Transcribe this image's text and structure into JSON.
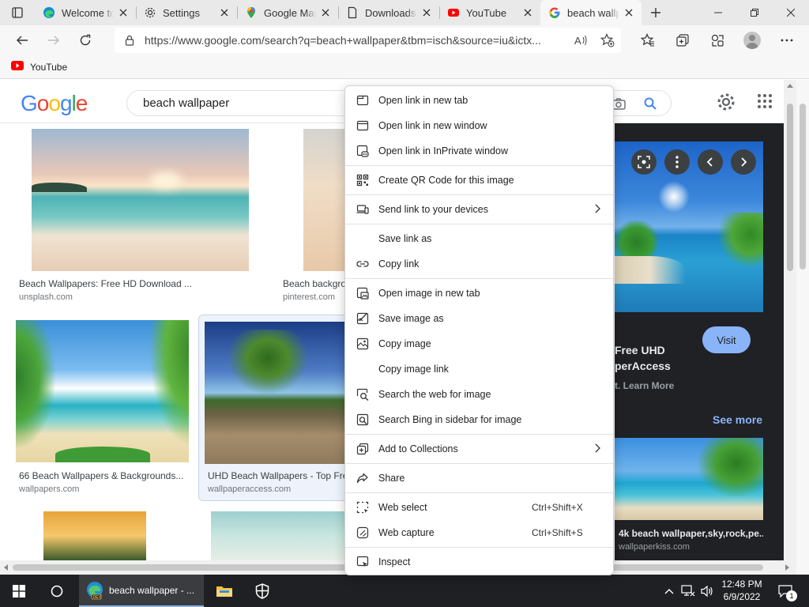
{
  "tabs": [
    {
      "title": "Welcome to Microsoft Edge",
      "icon": "edge-icon"
    },
    {
      "title": "Settings",
      "icon": "gear-icon"
    },
    {
      "title": "Google Maps",
      "icon": "maps-pin-icon"
    },
    {
      "title": "Downloads",
      "icon": "document-icon"
    },
    {
      "title": "YouTube",
      "icon": "youtube-icon"
    },
    {
      "title": "beach wallpaper - Google Search",
      "icon": "google-g-icon"
    }
  ],
  "address": {
    "url": "https://www.google.com/search?q=beach+wallpaper&tbm=isch&source=iu&ictx..."
  },
  "favorites": [
    {
      "label": "YouTube"
    }
  ],
  "google": {
    "logo": "Google",
    "query": "beach wallpaper"
  },
  "results": [
    {
      "caption": "Beach Wallpapers: Free HD Download ...",
      "source": "unsplash.com"
    },
    {
      "caption": "Beach backgrounds",
      "source": "pinterest.com"
    },
    {
      "caption": "66 Beach Wallpapers & Backgrounds...",
      "source": "wallpapers.com"
    },
    {
      "caption": "UHD Beach Wallpapers - Top Free",
      "source": "wallpaperaccess.com"
    }
  ],
  "panel": {
    "title": "Free UHD\nperAccess",
    "learn": "t. Learn More",
    "visit": "Visit",
    "see_more": "See more",
    "related_caption": "4k beach wallpaper,sky,rock,pe...",
    "related_source": "wallpaperkiss.com"
  },
  "context_menu": [
    {
      "label": "Open link in new tab",
      "icon": "new-tab-icon"
    },
    {
      "label": "Open link in new window",
      "icon": "new-window-icon"
    },
    {
      "label": "Open link in InPrivate window",
      "icon": "inprivate-icon"
    },
    {
      "label": "Create QR Code for this image",
      "icon": "qr-code-icon"
    },
    {
      "label": "Send link to your devices",
      "icon": "send-devices-icon"
    },
    {
      "label": "Save link as",
      "icon": ""
    },
    {
      "label": "Copy link",
      "icon": "link-icon"
    },
    {
      "label": "Open image in new tab",
      "icon": "image-new-tab-icon"
    },
    {
      "label": "Save image as",
      "icon": "save-image-icon"
    },
    {
      "label": "Copy image",
      "icon": "copy-image-icon"
    },
    {
      "label": "Copy image link",
      "icon": ""
    },
    {
      "label": "Search the web for image",
      "icon": "image-search-icon"
    },
    {
      "label": "Search Bing in sidebar for image",
      "icon": "sidebar-search-icon"
    },
    {
      "label": "Add to Collections",
      "icon": "collections-icon"
    },
    {
      "label": "Share",
      "icon": "share-icon"
    },
    {
      "label": "Web select",
      "icon": "web-select-icon",
      "shortcut": "Ctrl+Shift+X"
    },
    {
      "label": "Web capture",
      "icon": "web-capture-icon",
      "shortcut": "Ctrl+Shift+S"
    },
    {
      "label": "Inspect",
      "icon": "inspect-icon"
    }
  ],
  "taskbar": {
    "edge_label": "beach wallpaper - ...",
    "time": "12:48 PM",
    "date": "6/9/2022",
    "notif_count": "1"
  },
  "colors": {
    "accent": "#1a73e8",
    "panel_bg": "#202124",
    "visit_btn": "#8ab4f8",
    "taskbar": "#1f2023"
  }
}
